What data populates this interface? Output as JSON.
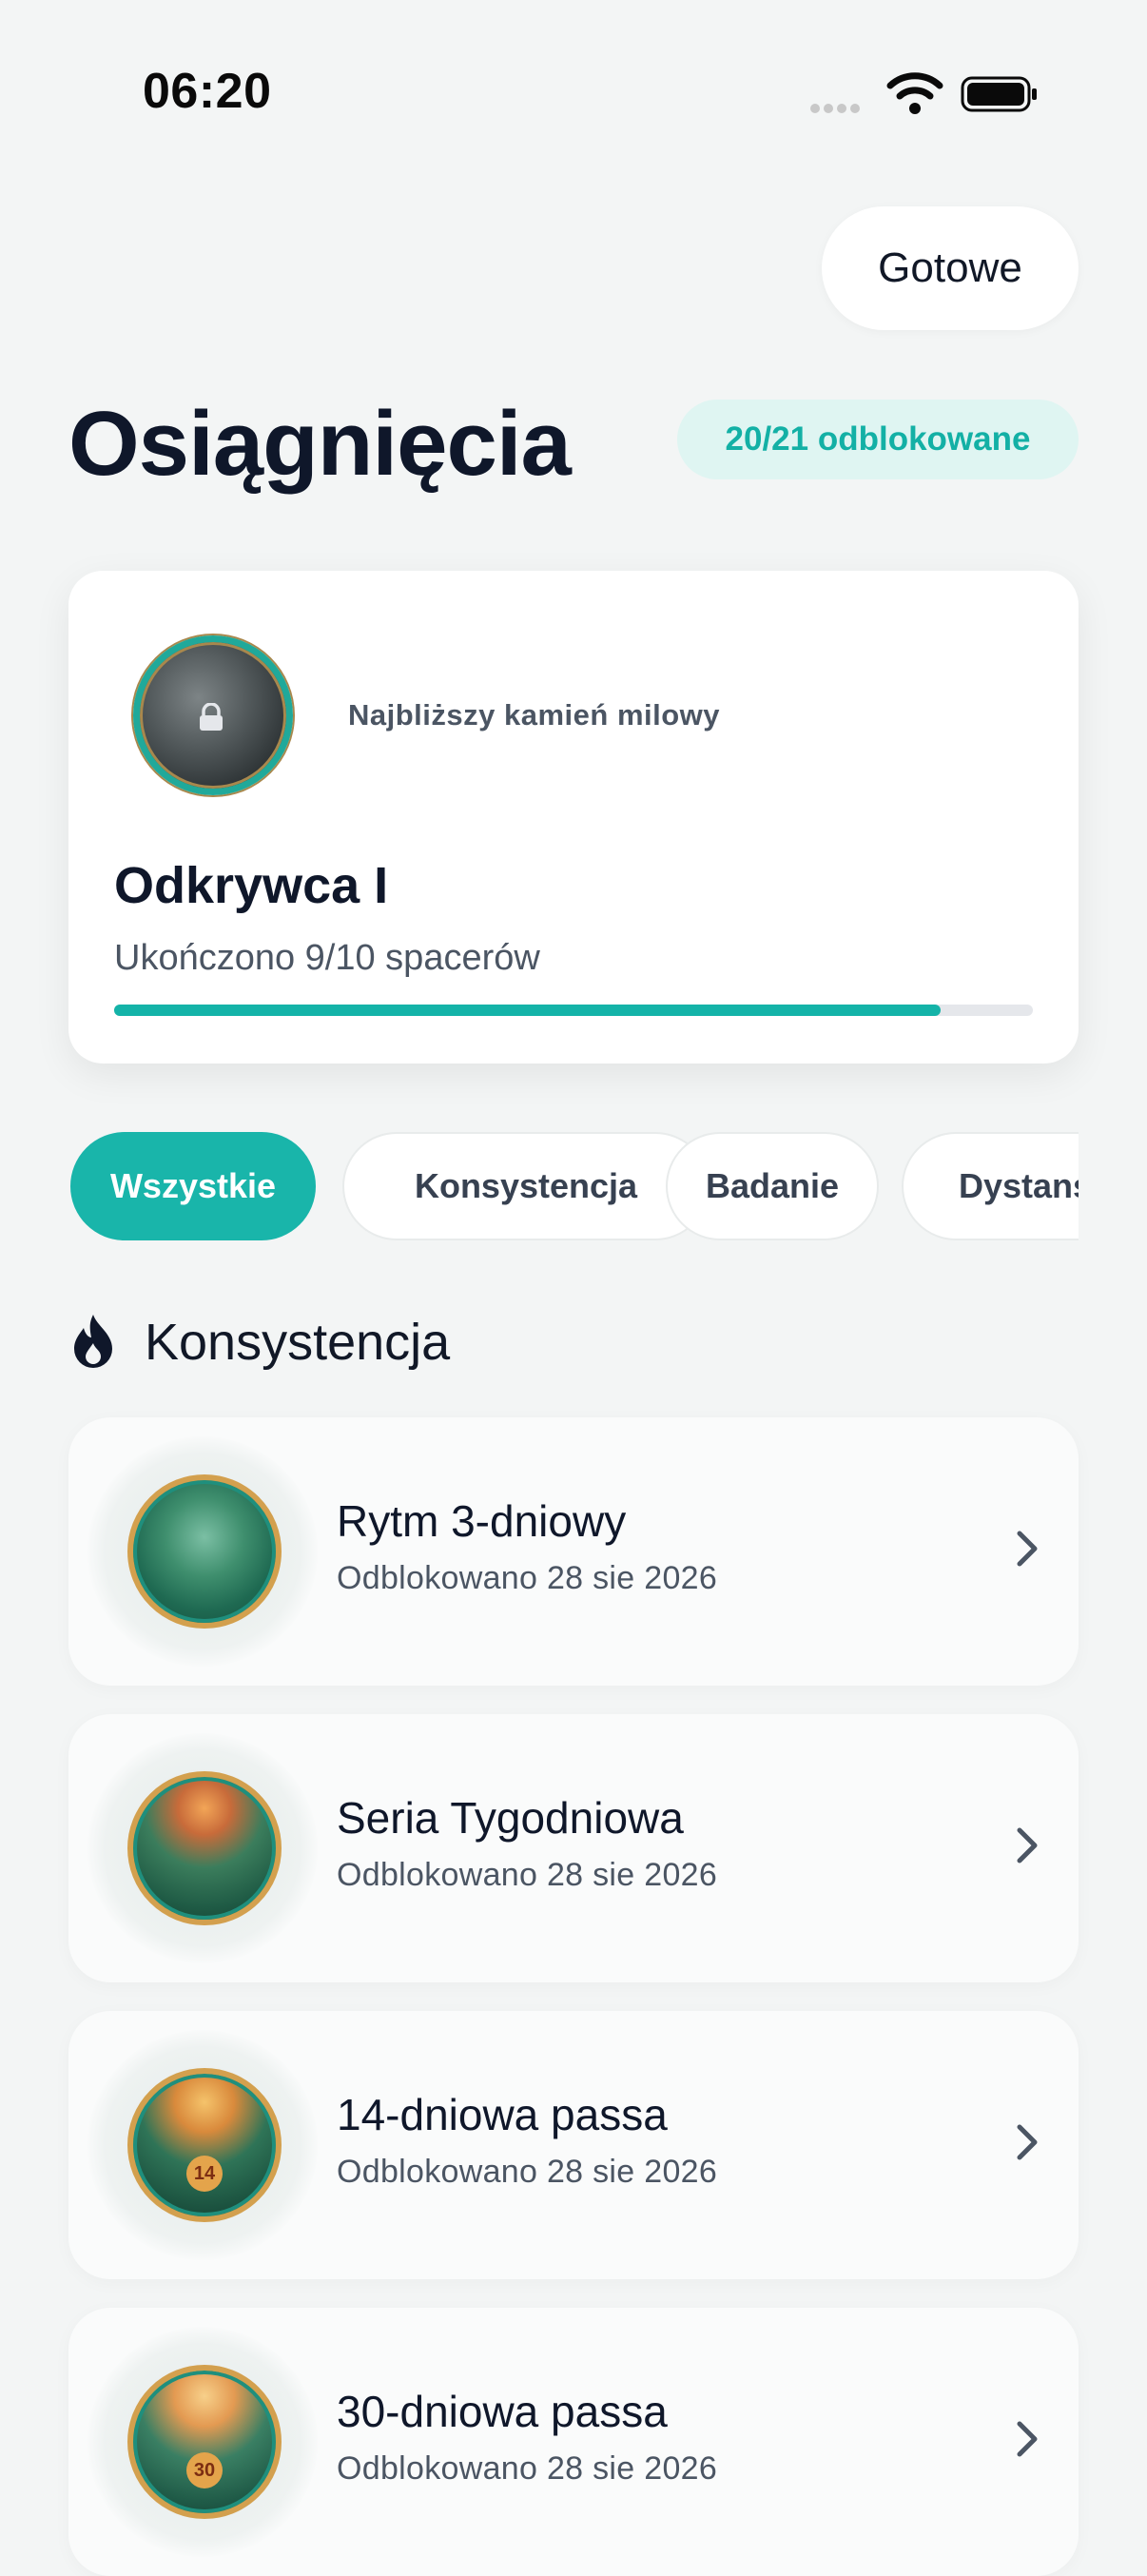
{
  "status_bar": {
    "time": "06:20",
    "icons": [
      "signal-icon",
      "wifi-icon",
      "battery-icon"
    ]
  },
  "header": {
    "done_label": "Gotowe",
    "title": "Osiągnięcia",
    "unlocked_badge": "20/21 odblokowane"
  },
  "milestone": {
    "label": "Najbliższy kamień milowy",
    "name": "Odkrywca I",
    "progress_text": "Ukończono 9/10 spacerów",
    "progress": 0.9,
    "badge_icon": "lock-icon"
  },
  "filters": {
    "chips": [
      "Wszystkie",
      "Konsystencja",
      "Badanie",
      "Dystans"
    ],
    "active": "Wszystkie"
  },
  "section": {
    "title": "Konsystencja",
    "icon": "flame-icon"
  },
  "achievements": [
    {
      "title": "Rytm 3-dniowy",
      "date": "Odblokowano 28 sie 2026"
    },
    {
      "title": "Seria Tygodniowa",
      "date": "Odblokowano 28 sie 2026"
    },
    {
      "title": "14-dniowa passa",
      "date": "Odblokowano 28 sie 2026",
      "badge_number": "14"
    },
    {
      "title": "30-dniowa passa",
      "date": "Odblokowano 28 sie 2026",
      "badge_number": "30"
    }
  ],
  "colors": {
    "accent": "#19b5aa",
    "badge_bg": "#dff5f2",
    "background": "#f3f5f5",
    "card": "#ffffff"
  }
}
